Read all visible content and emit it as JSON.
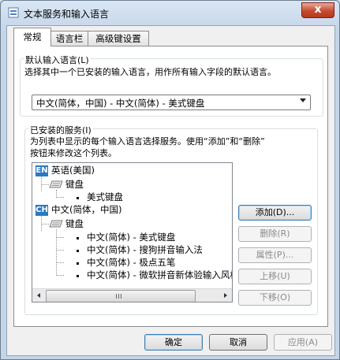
{
  "window": {
    "title": "文本服务和输入语言",
    "close_glyph": "x"
  },
  "tabs": [
    {
      "label": "常规",
      "active": true
    },
    {
      "label": "语言栏",
      "active": false
    },
    {
      "label": "高级键设置",
      "active": false
    }
  ],
  "default_language": {
    "group_label": "默认输入语言(L)",
    "description": "选择其中一个已安装的输入语言，用作所有输入字段的默认语言。",
    "selected": "中文(简体，中国) - 中文(简体) - 美式键盘"
  },
  "installed_services": {
    "group_label": "已安装的服务(I)",
    "description": [
      "为列表中显示的每个输入语言选择服务。使用“添加”和“删除”",
      "按钮来修改这个列表。"
    ],
    "tree": {
      "en_badge": "EN",
      "en_label": "英语(美国)",
      "en_keyboard": "键盘",
      "en_items": [
        "美式键盘"
      ],
      "ch_badge": "CH",
      "ch_label": "中文(简体，中国)",
      "ch_keyboard": "键盘",
      "ch_items": [
        "中文(简体) - 美式键盘",
        "中文(简体) - 搜狗拼音输入法",
        "中文(简体) - 极点五笔",
        "中文(简体) - 微软拼音新体验输入风格"
      ]
    },
    "buttons": {
      "add": "添加(D)...",
      "remove": "删除(R)",
      "properties": "属性(P)...",
      "move_up": "上移(U)",
      "move_down": "下移(O)"
    }
  },
  "footer": {
    "ok": "确定",
    "cancel": "取消",
    "apply": "应用(A)"
  },
  "colors": {
    "badge": "#2b78c2",
    "close": "#c74a2f"
  }
}
